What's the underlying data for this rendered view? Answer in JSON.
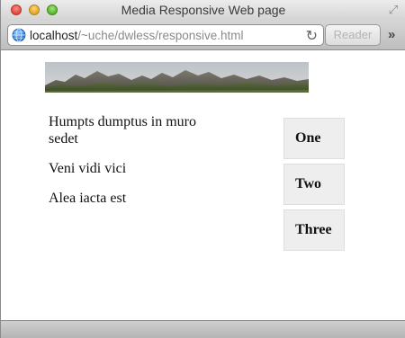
{
  "window": {
    "title": "Media Responsive Web page"
  },
  "toolbar": {
    "url_host": "localhost",
    "url_path": "/~uche/dwless/responsive.html",
    "reader_label": "Reader",
    "more_label": "»"
  },
  "content": {
    "texts": [
      "Humpts dumptus in muro sedet",
      "Veni vidi vici",
      "Alea iacta est"
    ],
    "boxes": [
      "One",
      "Two",
      "Three"
    ]
  },
  "icons": [
    "close-icon",
    "minimize-icon",
    "zoom-icon",
    "fullscreen-icon",
    "globe-icon",
    "reload-icon",
    "chevron-double-right-icon"
  ]
}
